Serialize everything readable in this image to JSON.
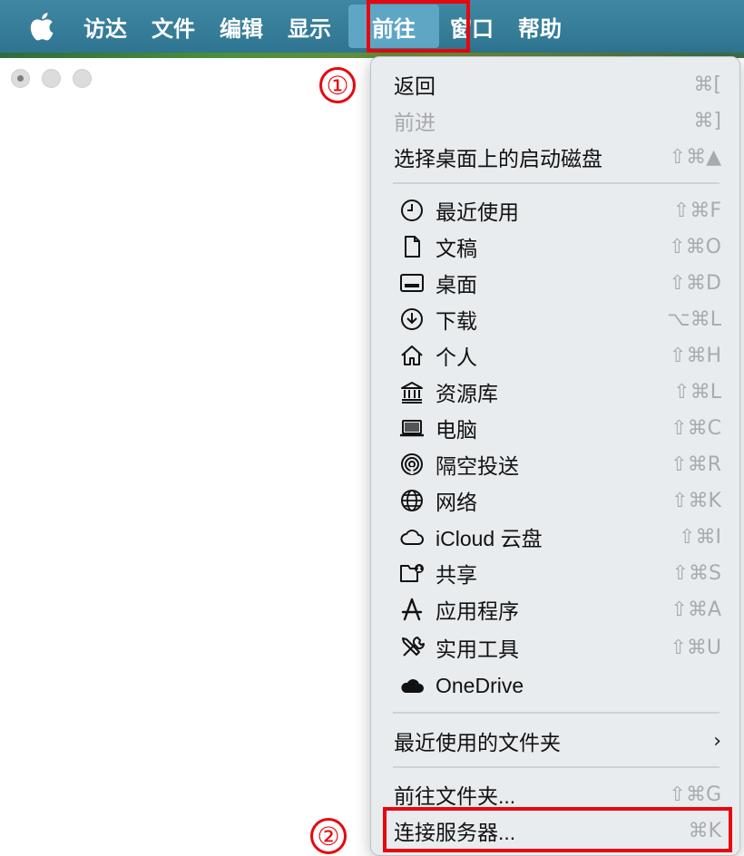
{
  "menubar": {
    "apple": "apple-logo-icon",
    "items": [
      "访达",
      "文件",
      "编辑",
      "显示",
      "前往",
      "窗口",
      "帮助"
    ],
    "active_index": 4
  },
  "annotations": {
    "step1": "①",
    "step2": "②"
  },
  "go_menu": {
    "back": {
      "label": "返回",
      "shortcut": "⌘["
    },
    "forward": {
      "label": "前进",
      "shortcut": "⌘]"
    },
    "startup_disk": {
      "label": "选择桌面上的启动磁盘",
      "shortcut": "⇧⌘▲"
    },
    "places": [
      {
        "label": "最近使用",
        "shortcut": "⇧⌘F",
        "icon": "clock-icon"
      },
      {
        "label": "文稿",
        "shortcut": "⇧⌘O",
        "icon": "document-icon"
      },
      {
        "label": "桌面",
        "shortcut": "⇧⌘D",
        "icon": "desktop-icon"
      },
      {
        "label": "下载",
        "shortcut": "⌥⌘L",
        "icon": "download-icon"
      },
      {
        "label": "个人",
        "shortcut": "⇧⌘H",
        "icon": "home-icon"
      },
      {
        "label": "资源库",
        "shortcut": "⇧⌘L",
        "icon": "library-icon"
      },
      {
        "label": "电脑",
        "shortcut": "⇧⌘C",
        "icon": "laptop-icon"
      },
      {
        "label": "隔空投送",
        "shortcut": "⇧⌘R",
        "icon": "airdrop-icon"
      },
      {
        "label": "网络",
        "shortcut": "⇧⌘K",
        "icon": "globe-icon"
      },
      {
        "label": "iCloud 云盘",
        "shortcut": "⇧⌘I",
        "icon": "cloud-icon"
      },
      {
        "label": "共享",
        "shortcut": "⇧⌘S",
        "icon": "shared-folder-icon"
      },
      {
        "label": "应用程序",
        "shortcut": "⇧⌘A",
        "icon": "applications-icon"
      },
      {
        "label": "实用工具",
        "shortcut": "⇧⌘U",
        "icon": "utilities-icon"
      },
      {
        "label": "OneDrive",
        "shortcut": "",
        "icon": "onedrive-cloud-icon"
      }
    ],
    "recent_folders": {
      "label": "最近使用的文件夹",
      "shortcut": "›"
    },
    "go_to_folder": {
      "label": "前往文件夹...",
      "shortcut": "⇧⌘G"
    },
    "connect_server": {
      "label": "连接服务器...",
      "shortcut": "⌘K"
    }
  },
  "colors": {
    "menubar": "#2f7591",
    "highlight": "#e8070f",
    "menu_bg": "#e9ecee"
  }
}
